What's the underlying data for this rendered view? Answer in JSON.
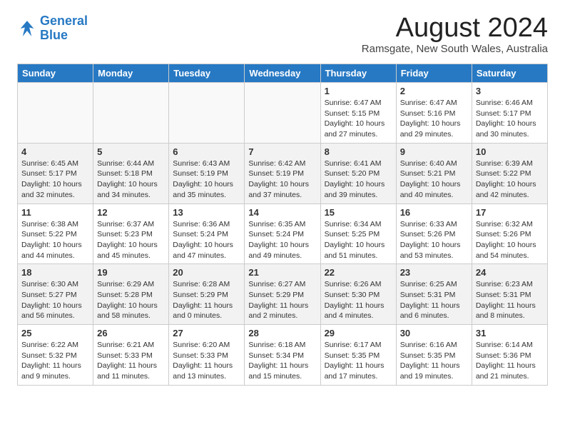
{
  "header": {
    "logo_line1": "General",
    "logo_line2": "Blue",
    "month_year": "August 2024",
    "location": "Ramsgate, New South Wales, Australia"
  },
  "weekdays": [
    "Sunday",
    "Monday",
    "Tuesday",
    "Wednesday",
    "Thursday",
    "Friday",
    "Saturday"
  ],
  "weeks": [
    [
      {
        "day": "",
        "info": ""
      },
      {
        "day": "",
        "info": ""
      },
      {
        "day": "",
        "info": ""
      },
      {
        "day": "",
        "info": ""
      },
      {
        "day": "1",
        "info": "Sunrise: 6:47 AM\nSunset: 5:15 PM\nDaylight: 10 hours\nand 27 minutes."
      },
      {
        "day": "2",
        "info": "Sunrise: 6:47 AM\nSunset: 5:16 PM\nDaylight: 10 hours\nand 29 minutes."
      },
      {
        "day": "3",
        "info": "Sunrise: 6:46 AM\nSunset: 5:17 PM\nDaylight: 10 hours\nand 30 minutes."
      }
    ],
    [
      {
        "day": "4",
        "info": "Sunrise: 6:45 AM\nSunset: 5:17 PM\nDaylight: 10 hours\nand 32 minutes."
      },
      {
        "day": "5",
        "info": "Sunrise: 6:44 AM\nSunset: 5:18 PM\nDaylight: 10 hours\nand 34 minutes."
      },
      {
        "day": "6",
        "info": "Sunrise: 6:43 AM\nSunset: 5:19 PM\nDaylight: 10 hours\nand 35 minutes."
      },
      {
        "day": "7",
        "info": "Sunrise: 6:42 AM\nSunset: 5:19 PM\nDaylight: 10 hours\nand 37 minutes."
      },
      {
        "day": "8",
        "info": "Sunrise: 6:41 AM\nSunset: 5:20 PM\nDaylight: 10 hours\nand 39 minutes."
      },
      {
        "day": "9",
        "info": "Sunrise: 6:40 AM\nSunset: 5:21 PM\nDaylight: 10 hours\nand 40 minutes."
      },
      {
        "day": "10",
        "info": "Sunrise: 6:39 AM\nSunset: 5:22 PM\nDaylight: 10 hours\nand 42 minutes."
      }
    ],
    [
      {
        "day": "11",
        "info": "Sunrise: 6:38 AM\nSunset: 5:22 PM\nDaylight: 10 hours\nand 44 minutes."
      },
      {
        "day": "12",
        "info": "Sunrise: 6:37 AM\nSunset: 5:23 PM\nDaylight: 10 hours\nand 45 minutes."
      },
      {
        "day": "13",
        "info": "Sunrise: 6:36 AM\nSunset: 5:24 PM\nDaylight: 10 hours\nand 47 minutes."
      },
      {
        "day": "14",
        "info": "Sunrise: 6:35 AM\nSunset: 5:24 PM\nDaylight: 10 hours\nand 49 minutes."
      },
      {
        "day": "15",
        "info": "Sunrise: 6:34 AM\nSunset: 5:25 PM\nDaylight: 10 hours\nand 51 minutes."
      },
      {
        "day": "16",
        "info": "Sunrise: 6:33 AM\nSunset: 5:26 PM\nDaylight: 10 hours\nand 53 minutes."
      },
      {
        "day": "17",
        "info": "Sunrise: 6:32 AM\nSunset: 5:26 PM\nDaylight: 10 hours\nand 54 minutes."
      }
    ],
    [
      {
        "day": "18",
        "info": "Sunrise: 6:30 AM\nSunset: 5:27 PM\nDaylight: 10 hours\nand 56 minutes."
      },
      {
        "day": "19",
        "info": "Sunrise: 6:29 AM\nSunset: 5:28 PM\nDaylight: 10 hours\nand 58 minutes."
      },
      {
        "day": "20",
        "info": "Sunrise: 6:28 AM\nSunset: 5:29 PM\nDaylight: 11 hours\nand 0 minutes."
      },
      {
        "day": "21",
        "info": "Sunrise: 6:27 AM\nSunset: 5:29 PM\nDaylight: 11 hours\nand 2 minutes."
      },
      {
        "day": "22",
        "info": "Sunrise: 6:26 AM\nSunset: 5:30 PM\nDaylight: 11 hours\nand 4 minutes."
      },
      {
        "day": "23",
        "info": "Sunrise: 6:25 AM\nSunset: 5:31 PM\nDaylight: 11 hours\nand 6 minutes."
      },
      {
        "day": "24",
        "info": "Sunrise: 6:23 AM\nSunset: 5:31 PM\nDaylight: 11 hours\nand 8 minutes."
      }
    ],
    [
      {
        "day": "25",
        "info": "Sunrise: 6:22 AM\nSunset: 5:32 PM\nDaylight: 11 hours\nand 9 minutes."
      },
      {
        "day": "26",
        "info": "Sunrise: 6:21 AM\nSunset: 5:33 PM\nDaylight: 11 hours\nand 11 minutes."
      },
      {
        "day": "27",
        "info": "Sunrise: 6:20 AM\nSunset: 5:33 PM\nDaylight: 11 hours\nand 13 minutes."
      },
      {
        "day": "28",
        "info": "Sunrise: 6:18 AM\nSunset: 5:34 PM\nDaylight: 11 hours\nand 15 minutes."
      },
      {
        "day": "29",
        "info": "Sunrise: 6:17 AM\nSunset: 5:35 PM\nDaylight: 11 hours\nand 17 minutes."
      },
      {
        "day": "30",
        "info": "Sunrise: 6:16 AM\nSunset: 5:35 PM\nDaylight: 11 hours\nand 19 minutes."
      },
      {
        "day": "31",
        "info": "Sunrise: 6:14 AM\nSunset: 5:36 PM\nDaylight: 11 hours\nand 21 minutes."
      }
    ]
  ]
}
